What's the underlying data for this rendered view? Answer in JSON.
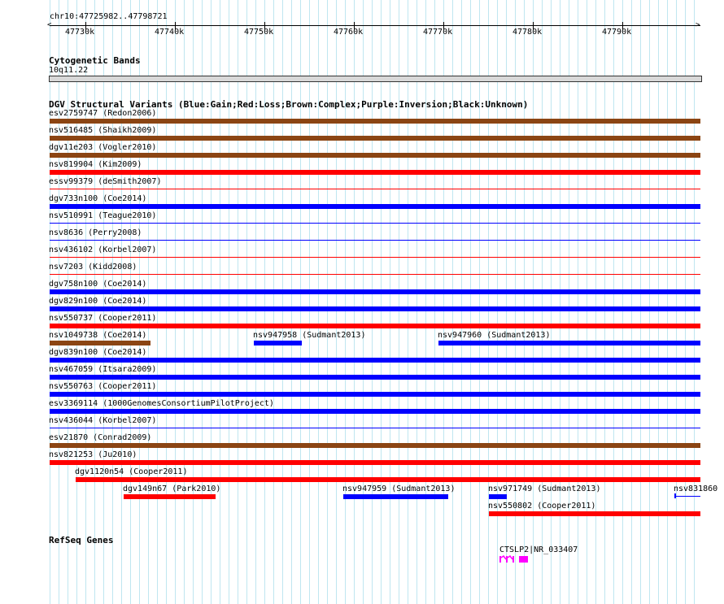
{
  "colors": {
    "gain": "#0000ff",
    "loss": "#ff0000",
    "complex": "#8b4513",
    "inversion": "#800080",
    "unknown": "#000000",
    "grid": "#bfe6f0",
    "gene": "#ff00ff"
  },
  "ruler": {
    "position_label": "chr10:47725982..47798721",
    "start": 47725982,
    "end": 47798721,
    "ticks": [
      {
        "pos": 47730000,
        "label": "47730k"
      },
      {
        "pos": 47740000,
        "label": "47740k"
      },
      {
        "pos": 47750000,
        "label": "47750k"
      },
      {
        "pos": 47760000,
        "label": "47760k"
      },
      {
        "pos": 47770000,
        "label": "47770k"
      },
      {
        "pos": 47780000,
        "label": "47780k"
      },
      {
        "pos": 47790000,
        "label": "47790k"
      }
    ]
  },
  "cytobands": {
    "title": "Cytogenetic Bands",
    "band": "10q11.22"
  },
  "dgv": {
    "title": "DGV Structural Variants (Blue:Gain;Red:Loss;Brown:Complex;Purple:Inversion;Black:Unknown)",
    "rows": [
      [
        {
          "label": "esv2759747 (Redon2006)",
          "type": "complex",
          "start": 47725982,
          "end": 47798721,
          "thick": true
        }
      ],
      [
        {
          "label": "nsv516485 (Shaikh2009)",
          "type": "complex",
          "start": 47725982,
          "end": 47798721,
          "thick": true
        }
      ],
      [
        {
          "label": "dgv11e203 (Vogler2010)",
          "type": "complex",
          "start": 47725982,
          "end": 47798721,
          "thick": true
        }
      ],
      [
        {
          "label": "nsv819904 (Kim2009)",
          "type": "loss",
          "start": 47725982,
          "end": 47798721,
          "thick": true
        }
      ],
      [
        {
          "label": "essv99379 (deSmith2007)",
          "type": "loss",
          "start": 47725982,
          "end": 47798721,
          "thick": false
        }
      ],
      [
        {
          "label": "dgv733n100 (Coe2014)",
          "type": "gain",
          "start": 47725982,
          "end": 47798721,
          "thick": true
        }
      ],
      [
        {
          "label": "nsv510991 (Teague2010)",
          "type": "gain",
          "start": 47725982,
          "end": 47798721,
          "thick": false
        }
      ],
      [
        {
          "label": "nsv8636 (Perry2008)",
          "type": "gain",
          "start": 47725982,
          "end": 47798721,
          "thick": false
        }
      ],
      [
        {
          "label": "nsv436102 (Korbel2007)",
          "type": "loss",
          "start": 47725982,
          "end": 47798721,
          "thick": false
        }
      ],
      [
        {
          "label": "nsv7203 (Kidd2008)",
          "type": "loss",
          "start": 47725982,
          "end": 47798721,
          "thick": false
        }
      ],
      [
        {
          "label": "dgv758n100 (Coe2014)",
          "type": "gain",
          "start": 47725982,
          "end": 47798721,
          "thick": true
        }
      ],
      [
        {
          "label": "dgv829n100 (Coe2014)",
          "type": "gain",
          "start": 47725982,
          "end": 47798721,
          "thick": true
        }
      ],
      [
        {
          "label": "nsv550737 (Cooper2011)",
          "type": "loss",
          "start": 47725982,
          "end": 47798721,
          "thick": true
        }
      ],
      [
        {
          "label": "nsv1049738 (Coe2014)",
          "type": "complex",
          "start": 47725982,
          "end": 47737300,
          "thick": true
        },
        {
          "label": "nsv947958 (Sudmant2013)",
          "type": "gain",
          "start": 47748800,
          "end": 47754200,
          "thick": true
        },
        {
          "label": "nsv947960 (Sudmant2013)",
          "type": "gain",
          "start": 47769400,
          "end": 47798721,
          "thick": true
        }
      ],
      [
        {
          "label": "dgv839n100 (Coe2014)",
          "type": "gain",
          "start": 47725982,
          "end": 47798721,
          "thick": true
        }
      ],
      [
        {
          "label": "nsv467059 (Itsara2009)",
          "type": "gain",
          "start": 47725982,
          "end": 47798721,
          "thick": true
        }
      ],
      [
        {
          "label": "nsv550763 (Cooper2011)",
          "type": "gain",
          "start": 47725982,
          "end": 47798721,
          "thick": true
        }
      ],
      [
        {
          "label": "esv3369114 (1000GenomesConsortiumPilotProject)",
          "type": "gain",
          "start": 47725982,
          "end": 47798721,
          "thick": true
        }
      ],
      [
        {
          "label": "nsv436044 (Korbel2007)",
          "type": "gain",
          "start": 47725982,
          "end": 47798721,
          "thick": false
        }
      ],
      [
        {
          "label": "esv21870 (Conrad2009)",
          "type": "complex",
          "start": 47725982,
          "end": 47798721,
          "thick": true
        }
      ],
      [
        {
          "label": "nsv821253 (Ju2010)",
          "type": "loss",
          "start": 47725982,
          "end": 47798721,
          "thick": true
        }
      ],
      [
        {
          "label": "dgv1120n54 (Cooper2011)",
          "type": "loss",
          "start": 47728900,
          "end": 47798721,
          "thick": true
        }
      ],
      [
        {
          "label": "dgv149n67 (Park2010)",
          "type": "loss",
          "start": 47734300,
          "end": 47744600,
          "thick": true
        },
        {
          "label": "nsv947959 (Sudmant2013)",
          "type": "gain",
          "start": 47758800,
          "end": 47770500,
          "thick": true
        },
        {
          "label": "nsv971749 (Sudmant2013)",
          "type": "gain",
          "start": 47775100,
          "end": 47777100,
          "thick": true
        },
        {
          "label": "nsv831860 (",
          "type": "gain",
          "start": 47795800,
          "end": 47798721,
          "thick": false
        }
      ],
      [
        {
          "label": "nsv550802 (Cooper2011)",
          "type": "loss",
          "start": 47775100,
          "end": 47798721,
          "thick": true
        }
      ]
    ]
  },
  "refseq": {
    "title": "RefSeq Genes",
    "gene_label": "CTSLP2|NR_033407",
    "start": 47776300,
    "end": 47779400
  }
}
